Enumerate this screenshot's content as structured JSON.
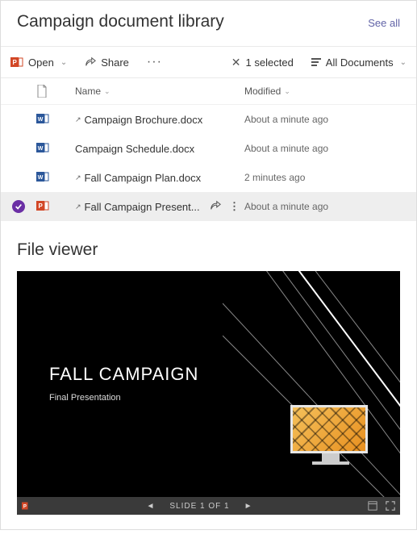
{
  "library": {
    "title": "Campaign document library",
    "see_all": "See all",
    "toolbar": {
      "open": "Open",
      "share": "Share",
      "selected_count": "1 selected",
      "view": "All Documents"
    },
    "columns": {
      "name": "Name",
      "modified": "Modified"
    },
    "rows": [
      {
        "type": "word",
        "shared": true,
        "name": "Campaign Brochure.docx",
        "modified": "About a minute ago",
        "selected": false
      },
      {
        "type": "word",
        "shared": false,
        "name": "Campaign Schedule.docx",
        "modified": "About a minute ago",
        "selected": false
      },
      {
        "type": "word",
        "shared": true,
        "name": "Fall Campaign Plan.docx",
        "modified": "2 minutes ago",
        "selected": false
      },
      {
        "type": "ppt",
        "shared": true,
        "name": "Fall Campaign Present...",
        "modified": "About a minute ago",
        "selected": true
      }
    ]
  },
  "viewer": {
    "title": "File viewer",
    "slide_title": "FALL CAMPAIGN",
    "slide_sub": "Final Presentation",
    "status": "SLIDE 1 OF 1"
  }
}
